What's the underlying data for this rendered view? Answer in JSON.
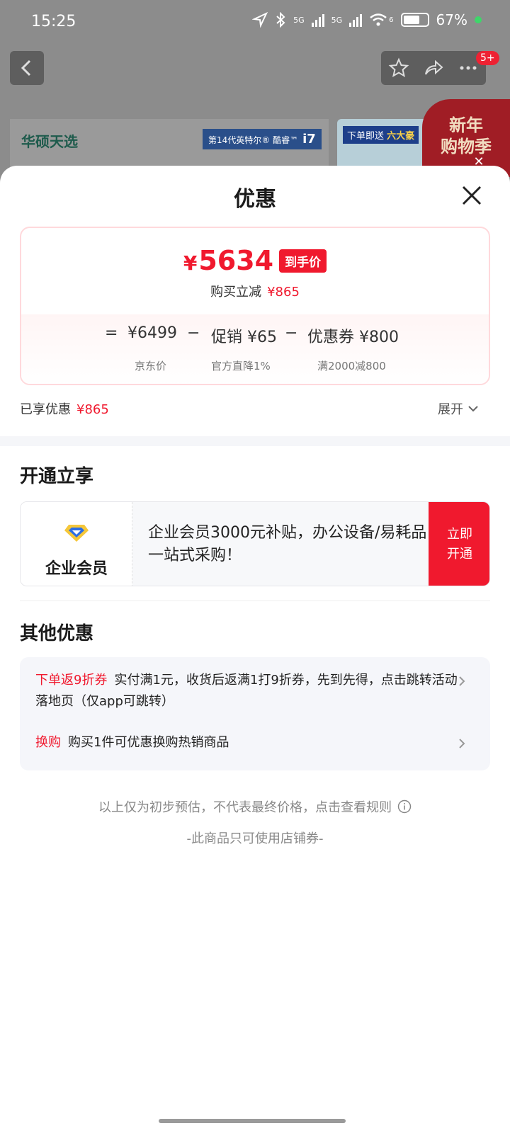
{
  "status_bar": {
    "time": "15:25",
    "network_1": "5G",
    "network_2": "5G",
    "wifi_sub": "6",
    "battery": "67%",
    "icons": [
      "location-icon",
      "bluetooth-icon",
      "signal-icon",
      "wifi-icon",
      "battery-icon"
    ]
  },
  "top_nav": {
    "back_icon": "chevron-left-icon",
    "actions": [
      "star-icon",
      "share-icon",
      "more-icon"
    ],
    "badge": "5+"
  },
  "background": {
    "banner_brand": "华硕天选",
    "banner_chip": "第14代英特尔® 酷睿™",
    "banner_chip_model": "i7",
    "banner2_chip_prefix": "下单即送",
    "banner2_chip_highlight": "六大豪",
    "promo_badge_line1": "新年",
    "promo_badge_line2": "购物季"
  },
  "sheet": {
    "title": "优惠",
    "price": {
      "currency": "¥",
      "final": "5634",
      "tag": "到手价",
      "sub_label": "购买立减",
      "sub_amount": "¥865"
    },
    "formula": {
      "eq": "=",
      "base": "¥6499",
      "minus1": "−",
      "promo": "促销 ¥65",
      "minus2": "−",
      "coupon": "优惠券 ¥800",
      "base_label": "京东价",
      "promo_label": "官方直降1%",
      "coupon_label": "满2000减800"
    },
    "enjoyed_label": "已享优惠",
    "enjoyed_amount": "¥865",
    "expand_label": "展开",
    "open_section": {
      "title": "开通立享",
      "member_name": "企业会员",
      "member_desc": "企业会员3000元补贴，办公设备/易耗品一站式采购！",
      "button_line1": "立即",
      "button_line2": "开通"
    },
    "other_section": {
      "title": "其他优惠",
      "offers": [
        {
          "tag": "下单返9折券",
          "text": "实付满1元，收货后返满1打9折券，先到先得，点击跳转活动落地页（仅app可跳转）"
        },
        {
          "tag": "换购",
          "text": "购买1件可优惠换购热销商品"
        }
      ]
    },
    "footer_note": "以上仅为初步预估，不代表最终价格，点击查看规则",
    "footer_note2": "-此商品只可使用店铺券-"
  },
  "colors": {
    "accent_red": "#f0192e",
    "overlay": "#7a7a7a",
    "card_border": "#ffd9dc"
  }
}
